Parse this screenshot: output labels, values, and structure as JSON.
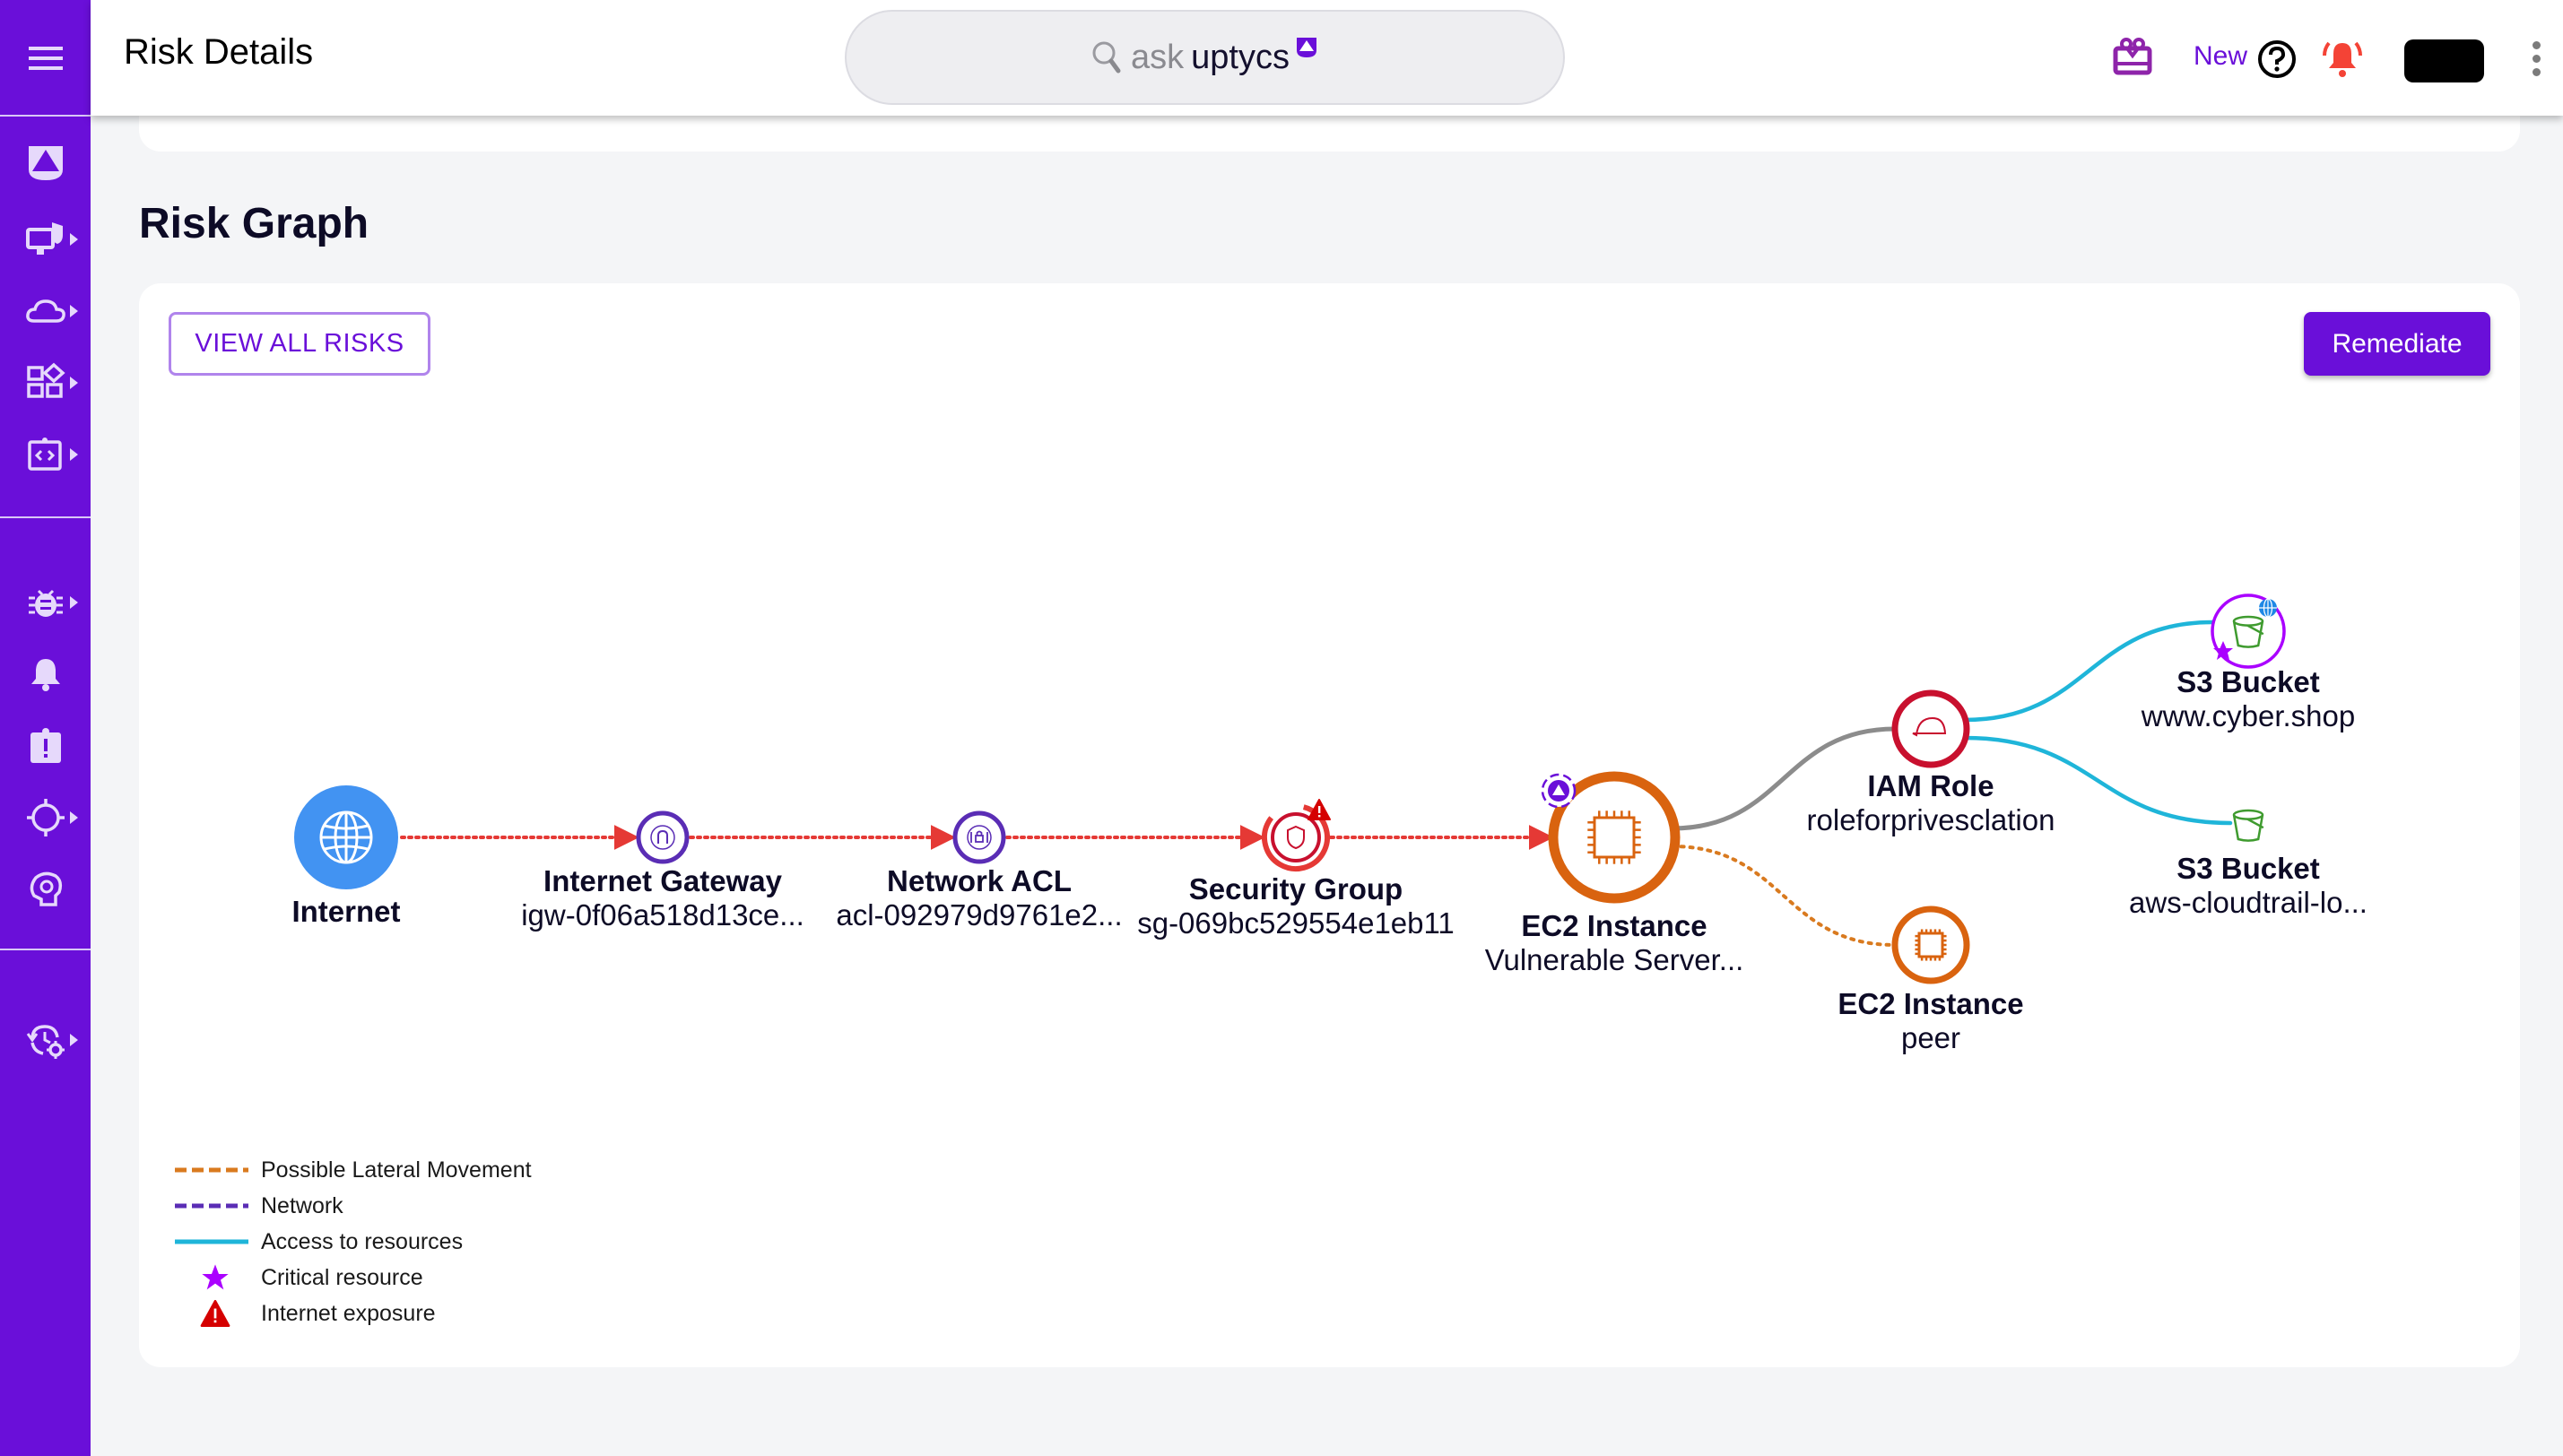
{
  "header": {
    "title": "Risk Details",
    "search": {
      "ask": "ask",
      "brand": "uptycs"
    },
    "new_label": "New"
  },
  "sidebar": {
    "items": [
      {
        "name": "home",
        "icon": "uptycs-logo-icon",
        "has_submenu": false
      },
      {
        "name": "endpoint-security",
        "icon": "monitor-shield-icon",
        "has_submenu": true
      },
      {
        "name": "cloud",
        "icon": "cloud-icon",
        "has_submenu": true
      },
      {
        "name": "applications",
        "icon": "widgets-icon",
        "has_submenu": true
      },
      {
        "name": "code-security",
        "icon": "code-tablet-icon",
        "has_submenu": true
      },
      {
        "name": "vulnerabilities",
        "icon": "bug-icon",
        "has_submenu": true
      },
      {
        "name": "alerts",
        "icon": "bell-icon",
        "has_submenu": false
      },
      {
        "name": "incidents",
        "icon": "alert-clipboard-icon",
        "has_submenu": false
      },
      {
        "name": "detections",
        "icon": "target-icon",
        "has_submenu": true
      },
      {
        "name": "ai-insights",
        "icon": "brain-gear-icon",
        "has_submenu": false
      },
      {
        "name": "settings-history",
        "icon": "history-gear-icon",
        "has_submenu": true
      }
    ]
  },
  "section": {
    "title": "Risk Graph"
  },
  "buttons": {
    "view_all": "VIEW ALL RISKS",
    "remediate": "Remediate"
  },
  "colors": {
    "brand": "#6a0fd9",
    "network_edge": "#e53935",
    "lateral_edge": "#d97a1f",
    "access_edge": "#1fb5d9",
    "ec2": "#d9630f",
    "iam": "#c8102e",
    "network_node": "#5a2db5",
    "s3": "#3f9b2f",
    "critical": "#aa00ff",
    "internet": "#4293f2"
  },
  "graph": {
    "nodes": [
      {
        "id": "internet",
        "title": "Internet",
        "subtitle": "",
        "icon": "globe-icon"
      },
      {
        "id": "igw",
        "title": "Internet Gateway",
        "subtitle": "igw-0f06a518d13ce...",
        "icon": "gateway-icon"
      },
      {
        "id": "acl",
        "title": "Network ACL",
        "subtitle": "acl-092979d9761e2...",
        "icon": "acl-lock-icon"
      },
      {
        "id": "sg",
        "title": "Security Group",
        "subtitle": "sg-069bc529554e1eb11",
        "icon": "shield-icon",
        "internet_exposure": true
      },
      {
        "id": "ec2",
        "title": "EC2 Instance",
        "subtitle": "Vulnerable Server...",
        "icon": "chip-icon",
        "uptycs_badge": true
      },
      {
        "id": "iam",
        "title": "IAM Role",
        "subtitle": "roleforprivesclation",
        "icon": "hardhat-icon"
      },
      {
        "id": "peer",
        "title": "EC2 Instance",
        "subtitle": "peer",
        "icon": "chip-icon"
      },
      {
        "id": "s3a",
        "title": "S3 Bucket",
        "subtitle": "www.cyber.shop",
        "icon": "bucket-icon",
        "critical": true,
        "public": true
      },
      {
        "id": "s3b",
        "title": "S3 Bucket",
        "subtitle": "aws-cloudtrail-lo...",
        "icon": "bucket-icon"
      }
    ],
    "edges": [
      {
        "from": "internet",
        "to": "igw",
        "type": "network"
      },
      {
        "from": "igw",
        "to": "acl",
        "type": "network"
      },
      {
        "from": "acl",
        "to": "sg",
        "type": "network"
      },
      {
        "from": "sg",
        "to": "ec2",
        "type": "network"
      },
      {
        "from": "ec2",
        "to": "iam",
        "type": "association"
      },
      {
        "from": "ec2",
        "to": "peer",
        "type": "lateral"
      },
      {
        "from": "iam",
        "to": "s3a",
        "type": "access"
      },
      {
        "from": "iam",
        "to": "s3b",
        "type": "access"
      }
    ]
  },
  "legend": [
    {
      "label": "Possible Lateral Movement",
      "kind": "lateral"
    },
    {
      "label": "Network",
      "kind": "network"
    },
    {
      "label": "Access to resources",
      "kind": "access"
    },
    {
      "label": "Critical resource",
      "kind": "critical"
    },
    {
      "label": "Internet exposure",
      "kind": "exposure"
    }
  ]
}
